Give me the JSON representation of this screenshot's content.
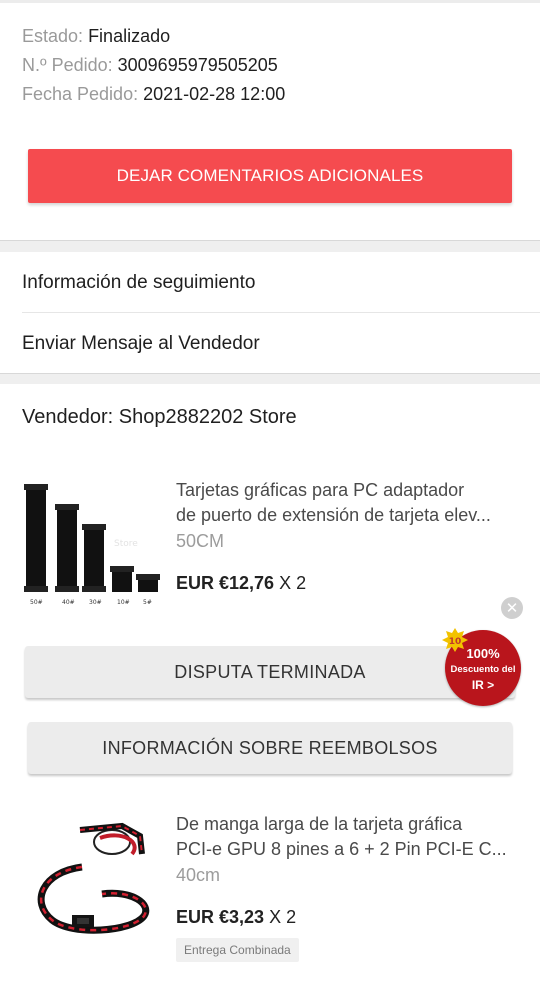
{
  "order": {
    "status_label": "Estado:",
    "status_value": "Finalizado",
    "number_label": "N.º Pedido:",
    "number_value": "3009695979505205",
    "date_label": "Fecha Pedido:",
    "date_value": "2021-02-28 12:00"
  },
  "actions": {
    "feedback_button": "DEJAR COMENTARIOS ADICIONALES"
  },
  "menu": {
    "tracking": "Información de seguimiento",
    "message_seller": "Enviar Mensaje al Vendedor"
  },
  "seller": {
    "label": "Vendedor: Shop2882202 Store"
  },
  "products": [
    {
      "title_line1": "Tarjetas gráficas para PC adaptador",
      "title_line2": "de puerto de extensión de tarjeta elev...",
      "variant": "50CM",
      "price": "EUR €12,76",
      "qty": "X 2",
      "thumb_labels": [
        "50#",
        "40#",
        "30#",
        "10#",
        "5#"
      ],
      "thumb_watermark": "Store"
    },
    {
      "title_line1": "De manga larga de la tarjeta gráfica",
      "title_line2": "PCI-e GPU 8 pines a 6 + 2 Pin PCI-E C...",
      "variant": "40cm",
      "price": "EUR €3,23",
      "qty": "X 2",
      "tag": "Entrega Combinada"
    }
  ],
  "buttons": {
    "dispute": "DISPUTA TERMINADA",
    "refund_info": "INFORMACIÓN SOBRE REEMBOLSOS"
  },
  "promo": {
    "coin": "10",
    "percent": "100%",
    "text": "Descuento del",
    "cta": "IR >"
  },
  "colors": {
    "accent_red": "#f54b4f",
    "promo_red": "#b9151c",
    "coin_gold": "#f2c200"
  }
}
